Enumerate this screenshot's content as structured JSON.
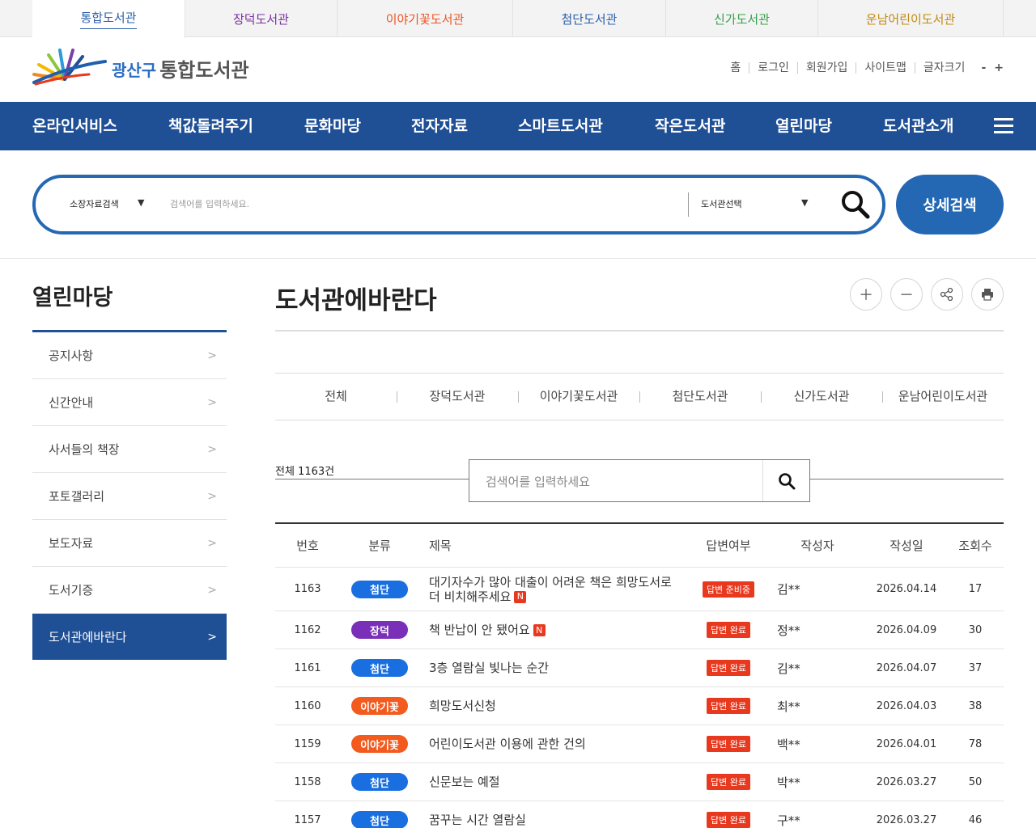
{
  "libtabs": [
    {
      "label": "통합도서관",
      "color": "#2a5fa8"
    },
    {
      "label": "장덕도서관",
      "color": "#7a2fa0"
    },
    {
      "label": "이야기꽃도서관",
      "color": "#ee5522"
    },
    {
      "label": "첨단도서관",
      "color": "#2a5fa8"
    },
    {
      "label": "신가도서관",
      "color": "#33a04a"
    },
    {
      "label": "운남어린이도서관",
      "color": "#c08a10"
    }
  ],
  "logo": {
    "part1": "광산구",
    "part2": "통합도서관"
  },
  "util": {
    "home": "홈",
    "login": "로그인",
    "join": "회원가입",
    "sitemap": "사이트맵",
    "fontsize": "글자크기",
    "minus": "-",
    "plus": "+"
  },
  "gnb": [
    "온라인서비스",
    "책값돌려주기",
    "문화마당",
    "전자자료",
    "스마트도서관",
    "작은도서관",
    "열린마당",
    "도서관소개"
  ],
  "search": {
    "type": "소장자료검색",
    "placeholder": "검색어를 입력하세요.",
    "library": "도서관선택",
    "detail": "상세검색"
  },
  "side": {
    "title": "열린마당",
    "items": [
      "공지사항",
      "신간안내",
      "사서들의 책장",
      "포토갤러리",
      "보도자료",
      "도서기증",
      "도서관에바란다"
    ]
  },
  "page": {
    "title": "도서관에바란다"
  },
  "libfilter": [
    "전체",
    "장덕도서관",
    "이야기꽃도서관",
    "첨단도서관",
    "신가도서관",
    "운남어린이도서관"
  ],
  "board": {
    "total": "전체 1163건",
    "placeholder": "검색어를 입력하세요"
  },
  "table": {
    "headers": {
      "no": "번호",
      "cat": "분류",
      "title": "제목",
      "answer": "답변여부",
      "writer": "작성자",
      "date": "작성일",
      "views": "조회수"
    },
    "rows": [
      {
        "no": "1163",
        "cat": "첨단",
        "catColor": "#1a6fe0",
        "title": "대기자수가 많아 대출이 어려운 책은 희망도서로 더 비치해주세요",
        "isNew": "N",
        "answer": "답변 준비중",
        "writer": "김**",
        "date": "2026.04.14",
        "views": "17"
      },
      {
        "no": "1162",
        "cat": "장덕",
        "catColor": "#7a2fb8",
        "title": "책 반납이 안 됐어요",
        "isNew": "N",
        "answer": "답변 완료",
        "writer": "정**",
        "date": "2026.04.09",
        "views": "30"
      },
      {
        "no": "1161",
        "cat": "첨단",
        "catColor": "#1a6fe0",
        "title": "3층 열람실 빛나는 순간",
        "isNew": "",
        "answer": "답변 완료",
        "writer": "김**",
        "date": "2026.04.07",
        "views": "37"
      },
      {
        "no": "1160",
        "cat": "이야기꽃",
        "catColor": "#f25a1e",
        "title": "희망도서신청",
        "isNew": "",
        "answer": "답변 완료",
        "writer": "최**",
        "date": "2026.04.03",
        "views": "38"
      },
      {
        "no": "1159",
        "cat": "이야기꽃",
        "catColor": "#f25a1e",
        "title": "어린이도서관 이용에 관한 건의",
        "isNew": "",
        "answer": "답변 완료",
        "writer": "백**",
        "date": "2026.04.01",
        "views": "78"
      },
      {
        "no": "1158",
        "cat": "첨단",
        "catColor": "#1a6fe0",
        "title": "신문보는 예절",
        "isNew": "",
        "answer": "답변 완료",
        "writer": "박**",
        "date": "2026.03.27",
        "views": "50"
      },
      {
        "no": "1157",
        "cat": "첨단",
        "catColor": "#1a6fe0",
        "title": "꿈꾸는 시간 열람실",
        "isNew": "",
        "answer": "답변 완료",
        "writer": "구**",
        "date": "2026.03.27",
        "views": "46"
      }
    ]
  }
}
